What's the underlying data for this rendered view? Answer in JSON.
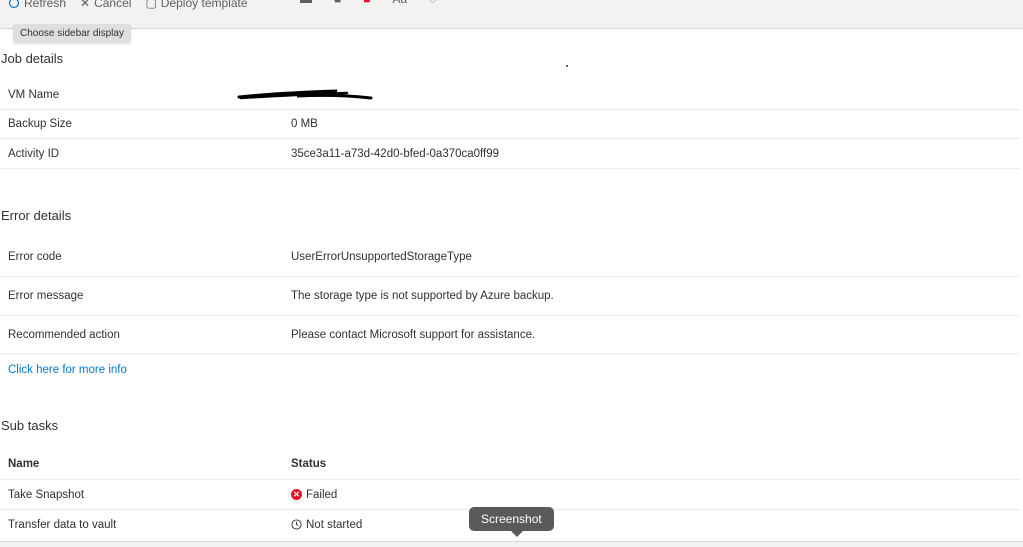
{
  "toolbar": {
    "refresh_label": "Refresh",
    "cancel_label": "Cancel",
    "deploy_label": "Deploy template",
    "tooltip": "Choose sidebar display",
    "annot_font_label": "Aa"
  },
  "job_details": {
    "title": "Job details",
    "rows": [
      {
        "key": "VM Name",
        "value": ""
      },
      {
        "key": "Backup Size",
        "value": "0 MB"
      },
      {
        "key": "Activity ID",
        "value": "35ce3a11-a73d-42d0-bfed-0a370ca0ff99"
      }
    ]
  },
  "error_details": {
    "title": "Error details",
    "rows": [
      {
        "key": "Error code",
        "value": "UserErrorUnsupportedStorageType"
      },
      {
        "key": "Error message",
        "value": "The storage type is not supported by Azure backup."
      },
      {
        "key": "Recommended action",
        "value": "Please contact Microsoft support for assistance."
      }
    ],
    "more_info_link": "Click here for more info"
  },
  "sub_tasks": {
    "title": "Sub tasks",
    "columns": [
      "Name",
      "Status"
    ],
    "rows": [
      {
        "name": "Take Snapshot",
        "status": "Failed",
        "status_icon": "error-x-icon"
      },
      {
        "name": "Transfer data to vault",
        "status": "Not started",
        "status_icon": "clock-icon"
      }
    ]
  },
  "screenshot_tooltip": "Screenshot",
  "colors": {
    "link": "#0078d4",
    "error": "#e81123",
    "divider": "#edebe9"
  }
}
